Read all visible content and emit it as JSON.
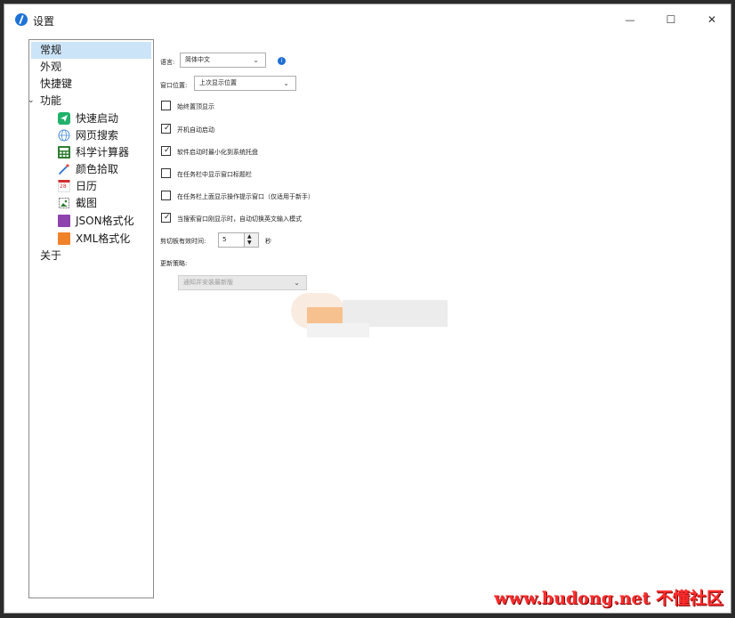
{
  "window": {
    "title": "设置",
    "controls": {
      "minimize": "—",
      "maximize": "☐",
      "close": "✕"
    }
  },
  "sidebar": {
    "items": [
      {
        "label": "常规",
        "selected": true
      },
      {
        "label": "外观"
      },
      {
        "label": "快捷键"
      },
      {
        "label": "功能",
        "expanded": true,
        "expander": "⌄"
      },
      {
        "label": "快速启动",
        "icon": "send-icon",
        "icon_color": "#20b26b"
      },
      {
        "label": "网页搜索",
        "icon": "globe-icon",
        "icon_color": "#4a90d9"
      },
      {
        "label": "科学计算器",
        "icon": "calculator-icon",
        "icon_color": "#2e7d32"
      },
      {
        "label": "颜色拾取",
        "icon": "eyedropper-icon",
        "icon_color": "#1e6fd1"
      },
      {
        "label": "日历",
        "icon": "calendar-icon",
        "icon_color": "#d32f2f",
        "icon_text": "28"
      },
      {
        "label": "截图",
        "icon": "screenshot-icon",
        "icon_color": "#2e7d32"
      },
      {
        "label": "JSON格式化",
        "icon": "json-file-icon",
        "icon_color": "#8e44ad"
      },
      {
        "label": "XML格式化",
        "icon": "xml-file-icon",
        "icon_color": "#f0822a"
      },
      {
        "label": "关于"
      }
    ]
  },
  "general": {
    "language": {
      "label": "语言:",
      "value": "简体中文",
      "arrow": "⌄"
    },
    "window_position": {
      "label": "窗口位置:",
      "value": "上次显示位置",
      "arrow": "⌄"
    },
    "checkboxes": [
      {
        "label": "始终置顶显示",
        "checked": false
      },
      {
        "label": "开机自动启动",
        "checked": true
      },
      {
        "label": "软件启动时最小化到系统托盘",
        "checked": true
      },
      {
        "label": "在任务栏中显示窗口标题栏",
        "checked": false
      },
      {
        "label": "在任务栏上面显示操作提示窗口（仅适用于新手）",
        "checked": false
      },
      {
        "label": "当搜索窗口刚显示时，自动切换英文输入模式",
        "checked": true
      }
    ],
    "clipboard": {
      "label": "剪切板有效时间:",
      "value": "5",
      "unit": "秒",
      "up": "▲",
      "down": "▼"
    },
    "update": {
      "label": "更新策略:",
      "value": "通知并安装最新版",
      "arrow": "⌄",
      "disabled": true
    },
    "info_glyph": "i",
    "check_glyph": "✓"
  },
  "watermark": "www.budong.net 不懂社区",
  "colors": {
    "accent": "#1e73d9",
    "selection": "#cce4f7",
    "watermark": "#ff2d2d"
  }
}
